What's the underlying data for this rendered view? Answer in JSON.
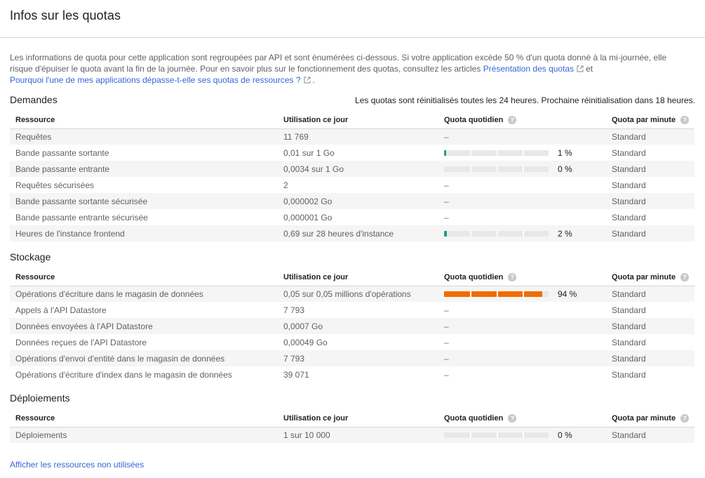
{
  "header": {
    "title": "Infos sur les quotas"
  },
  "intro": {
    "text": "Les informations de quota pour cette application sont regroupées par API et sont énumérées ci-dessous. Si votre application excède 50 % d'un quota donné à la mi-journée, elle risque d'épuiser le quota avant la fin de la journée. Pour en savoir plus sur le fonctionnement des quotas, consultez les articles ",
    "link1": "Présentation des quotas",
    "between": "et",
    "link2": "Pourquoi l'une de mes applications dépasse-t-elle ses quotas de ressources ?",
    "end": "."
  },
  "reset_note": "Les quotas sont réinitialisés toutes les 24 heures. Prochaine réinitialisation dans 18 heures.",
  "columns": {
    "resource": "Ressource",
    "usage": "Utilisation ce jour",
    "daily": "Quota quotidien",
    "per_minute": "Quota par minute"
  },
  "colors": {
    "bar_low": "#1e9e8c",
    "bar_high": "#ef6c00",
    "bar_track": "#e8e8e8",
    "link": "#3367d6"
  },
  "sections": [
    {
      "title": "Demandes",
      "rows": [
        {
          "resource": "Requêtes",
          "usage": "11 769",
          "daily_text": "–",
          "per_minute": "Standard"
        },
        {
          "resource": "Bande passante sortante",
          "usage": "0,01 sur 1 Go",
          "daily_pct": "1 %",
          "daily_fraction": 0.01,
          "per_minute": "Standard"
        },
        {
          "resource": "Bande passante entrante",
          "usage": "0,0034 sur 1 Go",
          "daily_pct": "0 %",
          "daily_fraction": 0.0,
          "per_minute": "Standard"
        },
        {
          "resource": "Requêtes sécurisées",
          "usage": "2",
          "daily_text": "–",
          "per_minute": "Standard"
        },
        {
          "resource": "Bande passante sortante sécurisée",
          "usage": "0,000002 Go",
          "daily_text": "–",
          "per_minute": "Standard"
        },
        {
          "resource": "Bande passante entrante sécurisée",
          "usage": "0,000001 Go",
          "daily_text": "–",
          "per_minute": "Standard"
        },
        {
          "resource": "Heures de l'instance frontend",
          "usage": "0,69 sur 28 heures d'instance",
          "daily_pct": "2 %",
          "daily_fraction": 0.025,
          "per_minute": "Standard"
        }
      ]
    },
    {
      "title": "Stockage",
      "rows": [
        {
          "resource": "Opérations d'écriture dans le magasin de données",
          "usage": "0,05 sur 0,05 millions d'opérations",
          "daily_pct": "94 %",
          "daily_fraction": 0.94,
          "per_minute": "Standard"
        },
        {
          "resource": "Appels à l'API Datastore",
          "usage": "7 793",
          "daily_text": "–",
          "per_minute": "Standard"
        },
        {
          "resource": "Données envoyées à l'API Datastore",
          "usage": "0,0007 Go",
          "daily_text": "–",
          "per_minute": "Standard"
        },
        {
          "resource": "Données reçues de l'API Datastore",
          "usage": "0,00049 Go",
          "daily_text": "–",
          "per_minute": "Standard"
        },
        {
          "resource": "Opérations d'envoi d'entité dans le magasin de données",
          "usage": "7 793",
          "daily_text": "–",
          "per_minute": "Standard"
        },
        {
          "resource": "Opérations d'écriture d'index dans le magasin de données",
          "usage": "39 071",
          "daily_text": "–",
          "per_minute": "Standard"
        }
      ]
    },
    {
      "title": "Déploiements",
      "rows": [
        {
          "resource": "Déploiements",
          "usage": "1 sur 10 000",
          "daily_pct": "0 %",
          "daily_fraction": 0.0,
          "per_minute": "Standard"
        }
      ]
    }
  ],
  "footer": {
    "show_unused": "Afficher les ressources non utilisées"
  }
}
